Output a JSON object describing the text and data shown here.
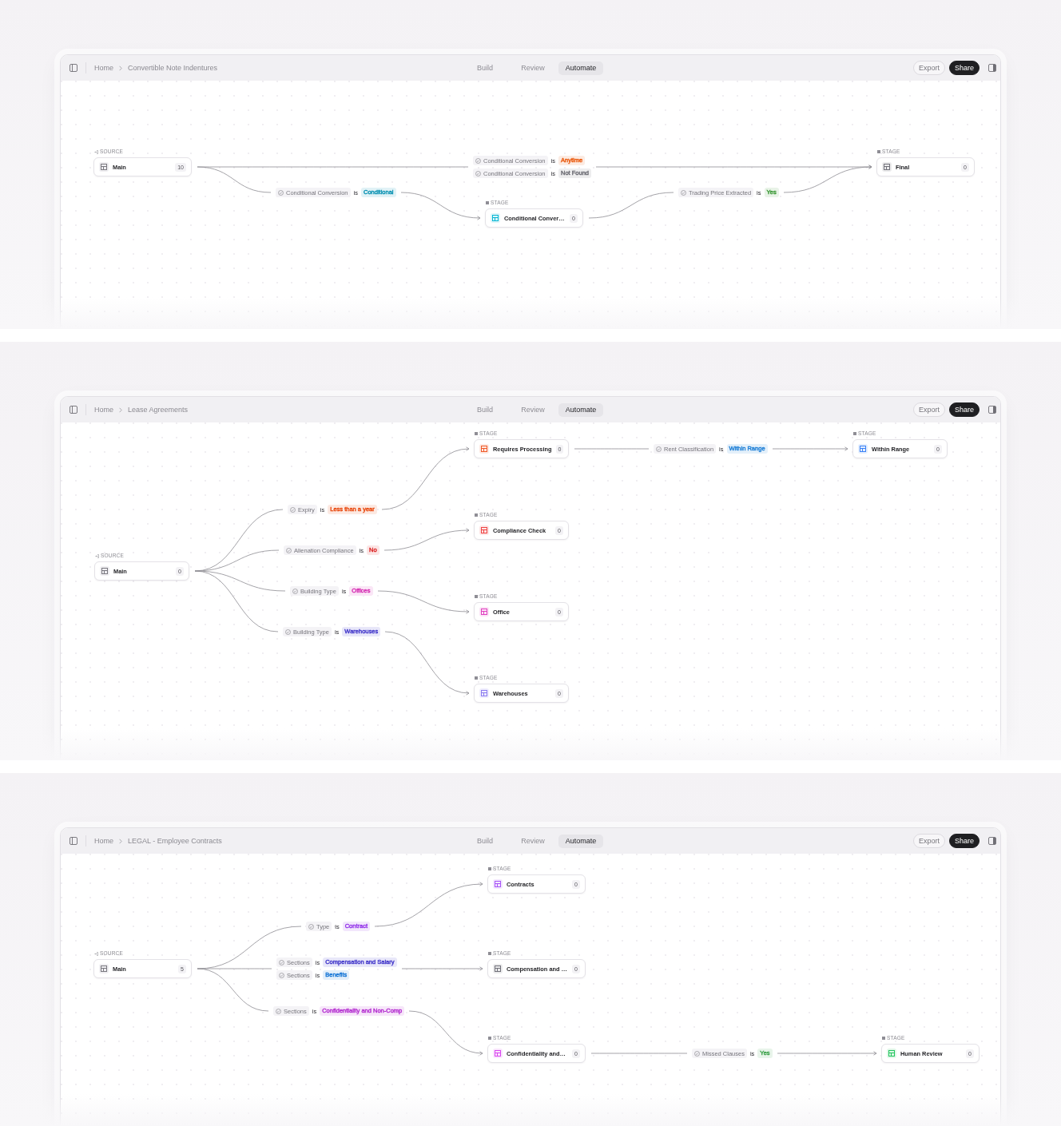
{
  "screens": [
    {
      "breadcrumb": {
        "home": "Home",
        "current": "Convertible Note Indentures"
      },
      "tabs": [
        {
          "label": "Build",
          "selected": false
        },
        {
          "label": "Review",
          "selected": false
        },
        {
          "label": "Automate",
          "selected": true
        }
      ],
      "actions": [
        {
          "label": "Export",
          "kind": "outline"
        },
        {
          "label": "Share",
          "kind": "filled"
        }
      ],
      "source": {
        "tag": "SOURCE",
        "name": "Main",
        "count": "10"
      },
      "stages": [
        {
          "tag": "STAGE",
          "name": "Conditional Conver…",
          "count": "0",
          "color": "#06b6d4"
        },
        {
          "tag": "STAGE",
          "name": "Final",
          "count": "0",
          "color": "#71717a"
        }
      ],
      "rules": [
        {
          "conditions": [
            {
              "field": "Conditional Conversion",
              "op": "is",
              "value": "Anytime",
              "color": "#ea580c"
            },
            {
              "field": "Conditional Conversion",
              "op": "is",
              "value": "Not Found",
              "color": "#6b6b73"
            }
          ]
        },
        {
          "conditions": [
            {
              "field": "Conditional Conversion",
              "op": "is",
              "value": "Conditional",
              "color": "#0891b2"
            }
          ]
        },
        {
          "conditions": [
            {
              "field": "Trading Price Extracted",
              "op": "is",
              "value": "Yes",
              "color": "#3f9a3a"
            }
          ]
        }
      ]
    },
    {
      "breadcrumb": {
        "home": "Home",
        "current": "Lease Agreements"
      },
      "tabs": [
        {
          "label": "Build",
          "selected": false
        },
        {
          "label": "Review",
          "selected": false
        },
        {
          "label": "Automate",
          "selected": true
        }
      ],
      "actions": [
        {
          "label": "Export",
          "kind": "outline"
        },
        {
          "label": "Share",
          "kind": "filled"
        }
      ],
      "source": {
        "tag": "SOURCE",
        "name": "Main",
        "count": "0"
      },
      "stages": [
        {
          "tag": "STAGE",
          "name": "Requires Processing",
          "count": "0",
          "color": "#f05a28"
        },
        {
          "tag": "STAGE",
          "name": "Compliance Check",
          "count": "0",
          "color": "#ef4444"
        },
        {
          "tag": "STAGE",
          "name": "Office",
          "count": "0",
          "color": "#e040c0"
        },
        {
          "tag": "STAGE",
          "name": "Warehouses",
          "count": "0",
          "color": "#8b7cf0"
        },
        {
          "tag": "STAGE",
          "name": "Within Range",
          "count": "0",
          "color": "#3b82f6"
        }
      ],
      "rules": [
        {
          "conditions": [
            {
              "field": "Expiry",
              "op": "is",
              "value": "Less than a year",
              "color": "#e8490f"
            }
          ]
        },
        {
          "conditions": [
            {
              "field": "Alienation Compliance",
              "op": "is",
              "value": "No",
              "color": "#dc2626"
            }
          ]
        },
        {
          "conditions": [
            {
              "field": "Building Type",
              "op": "is",
              "value": "Offices",
              "color": "#d631b4"
            }
          ]
        },
        {
          "conditions": [
            {
              "field": "Building Type",
              "op": "is",
              "value": "Warehouses",
              "color": "#4338ca"
            }
          ]
        },
        {
          "conditions": [
            {
              "field": "Rent Classification",
              "op": "is",
              "value": "Within Range",
              "color": "#1d7fd6"
            }
          ]
        }
      ]
    },
    {
      "breadcrumb": {
        "home": "Home",
        "current": "LEGAL - Employee Contracts"
      },
      "tabs": [
        {
          "label": "Build",
          "selected": false
        },
        {
          "label": "Review",
          "selected": false
        },
        {
          "label": "Automate",
          "selected": true
        }
      ],
      "actions": [
        {
          "label": "Export",
          "kind": "outline"
        },
        {
          "label": "Share",
          "kind": "filled"
        }
      ],
      "source": {
        "tag": "SOURCE",
        "name": "Main",
        "count": "5"
      },
      "stages": [
        {
          "tag": "STAGE",
          "name": "Contracts",
          "count": "0",
          "color": "#a855f7"
        },
        {
          "tag": "STAGE",
          "name": "Compensation and …",
          "count": "0",
          "color": "#71717a"
        },
        {
          "tag": "STAGE",
          "name": "Confidentiality and…",
          "count": "0",
          "color": "#d946ef"
        },
        {
          "tag": "STAGE",
          "name": "Human Review",
          "count": "0",
          "color": "#22c55e"
        }
      ],
      "rules": [
        {
          "conditions": [
            {
              "field": "Type",
              "op": "is",
              "value": "Contract",
              "color": "#9333ea"
            }
          ]
        },
        {
          "conditions": [
            {
              "field": "Sections",
              "op": "is",
              "value": "Compensation and Salary",
              "color": "#4338ca"
            },
            {
              "field": "Sections",
              "op": "is",
              "value": "Benefits",
              "color": "#1877d6"
            }
          ]
        },
        {
          "conditions": [
            {
              "field": "Sections",
              "op": "is",
              "value": "Confidentiality and Non-Comp",
              "color": "#b42ed0"
            }
          ]
        },
        {
          "conditions": [
            {
              "field": "Missed Clauses",
              "op": "is",
              "value": "Yes",
              "color": "#3fa34d"
            }
          ]
        }
      ]
    }
  ]
}
